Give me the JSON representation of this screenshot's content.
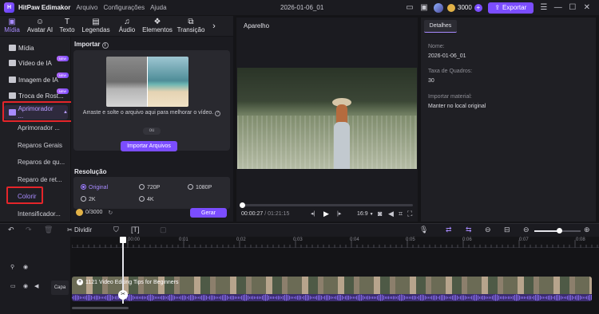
{
  "app": {
    "name": "HitPaw Edimakor",
    "menu": [
      "Arquivo",
      "Configurações",
      "Ajuda"
    ],
    "project_title": "2026-01-06_01",
    "credits": "3000",
    "export_label": "Exportar"
  },
  "tabs": [
    {
      "label": "Mídia",
      "icon": "media-icon"
    },
    {
      "label": "Avatar AI",
      "icon": "avatar-icon"
    },
    {
      "label": "Texto",
      "icon": "text-icon"
    },
    {
      "label": "Legendas",
      "icon": "subtitle-icon"
    },
    {
      "label": "Áudio",
      "icon": "audio-icon"
    },
    {
      "label": "Elementos",
      "icon": "elements-icon"
    },
    {
      "label": "Transição",
      "icon": "transition-icon"
    }
  ],
  "sidebar": {
    "items": [
      {
        "label": "Mídia"
      },
      {
        "label": "Vídeo de IA",
        "badge": "NEW"
      },
      {
        "label": "Imagem de IA",
        "badge": "NEW"
      },
      {
        "label": "Troca de Rost...",
        "badge": "NEW"
      },
      {
        "label": "Aprimorador ..."
      }
    ],
    "sub_items": [
      "Aprimorador ...",
      "Reparos Gerais",
      "Reparos de qu...",
      "Reparo de ret...",
      "Colorir",
      "Intensificador..."
    ]
  },
  "import": {
    "title": "Importar",
    "drop_text": "Arraste e solte o arquivo aqui para melhorar o vídeo.",
    "or": "ou",
    "button": "Importar Arquivos",
    "resolution_title": "Resolução",
    "options": [
      "Original",
      "720P",
      "1080P",
      "2K",
      "4K"
    ],
    "credits": "0/3000",
    "generate": "Gerar"
  },
  "player": {
    "title": "Aparelho",
    "current_time": "00:00:27",
    "total_time": "01:21:15",
    "ratio": "16:9",
    "progress": 0.005
  },
  "details": {
    "tab": "Detalhes",
    "fields": [
      {
        "label": "Nome:",
        "value": "2026-01-06_01"
      },
      {
        "label": "Taxa de Quadros:",
        "value": "30"
      },
      {
        "label": "Importar material:",
        "value": "Manter no local original"
      }
    ]
  },
  "timeline": {
    "split_label": "Dividir",
    "ticks": [
      "00:00",
      "0:01",
      "0:02",
      "0:03",
      "0:04",
      "0:05",
      "0:06",
      "0:07",
      "0:08",
      "0:09"
    ],
    "clip_title": "1121 Video Editing Tips for Beginners",
    "track_label": "Capa"
  },
  "colors": {
    "accent": "#7b4dff",
    "highlight": "#e5252a",
    "waveform": "#6a4fc8"
  }
}
